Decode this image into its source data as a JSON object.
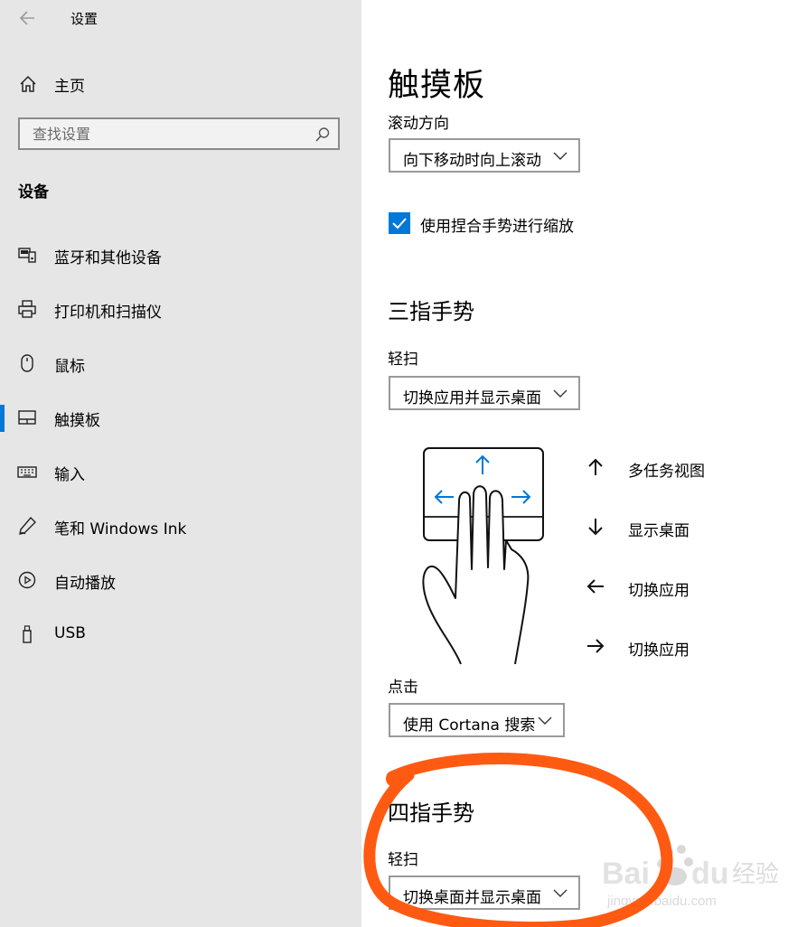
{
  "window": {
    "title": "设置",
    "back_icon": "back-arrow-icon"
  },
  "sidebar": {
    "home_label": "主页",
    "search_placeholder": "查找设置",
    "section_title": "设备",
    "items": [
      {
        "label": "蓝牙和其他设备",
        "icon": "bluetooth-devices-icon"
      },
      {
        "label": "打印机和扫描仪",
        "icon": "printer-icon"
      },
      {
        "label": "鼠标",
        "icon": "mouse-icon"
      },
      {
        "label": "触摸板",
        "icon": "touchpad-icon",
        "active": true
      },
      {
        "label": "输入",
        "icon": "keyboard-icon"
      },
      {
        "label": "笔和 Windows Ink",
        "icon": "pen-icon"
      },
      {
        "label": "自动播放",
        "icon": "autoplay-icon"
      },
      {
        "label": "USB",
        "icon": "usb-icon"
      }
    ],
    "accent_color": "#0078d7"
  },
  "main": {
    "title": "触摸板",
    "scroll_direction": {
      "label": "滚动方向",
      "value": "向下移动时向上滚动"
    },
    "pinch_zoom": {
      "label": "使用捏合手势进行缩放",
      "checked": true
    },
    "three_finger": {
      "heading": "三指手势",
      "swipe_label": "轻扫",
      "swipe_value": "切换应用并显示桌面",
      "mapping": [
        {
          "direction": "up",
          "action": "多任务视图"
        },
        {
          "direction": "down",
          "action": "显示桌面"
        },
        {
          "direction": "left",
          "action": "切换应用"
        },
        {
          "direction": "right",
          "action": "切换应用"
        }
      ],
      "tap_label": "点击",
      "tap_value": "使用 Cortana 搜索"
    },
    "four_finger": {
      "heading": "四指手势",
      "swipe_label": "轻扫",
      "swipe_value": "切换桌面并显示桌面"
    }
  },
  "overlay": {
    "annotation_color": "#ff5a12",
    "watermark": {
      "brand": "Bai du",
      "suffix": "经验",
      "url": "jingyan.baidu.com"
    }
  }
}
